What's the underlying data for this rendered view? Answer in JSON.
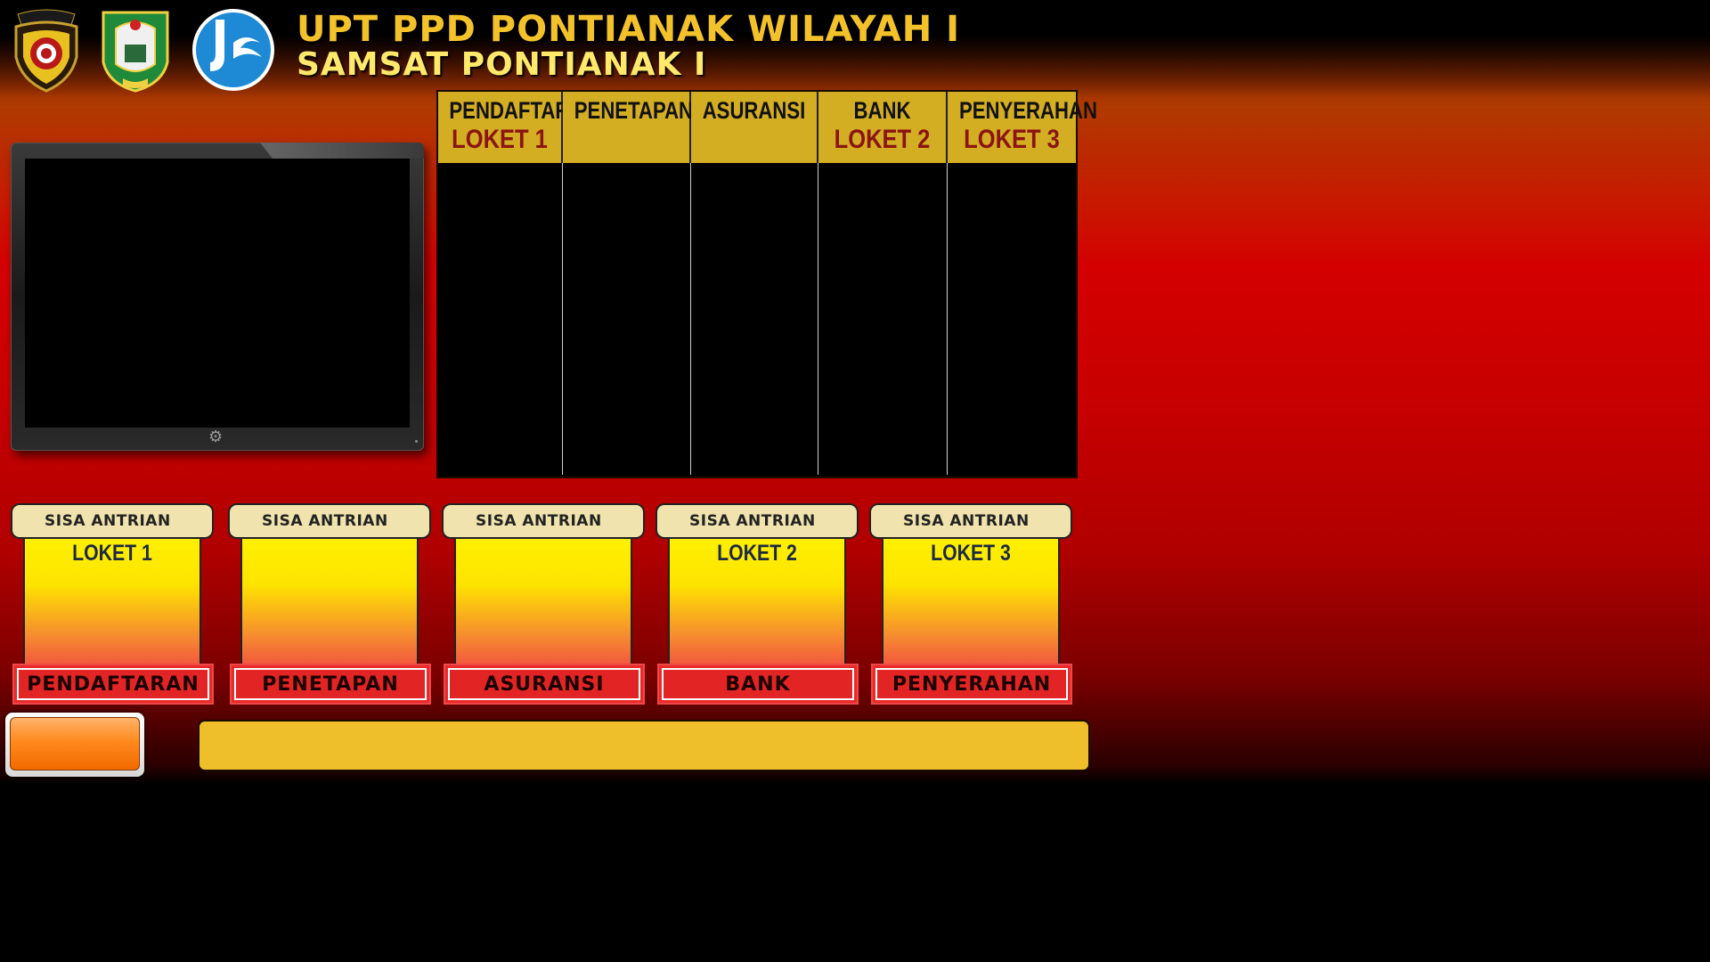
{
  "header": {
    "title": "UPT PPD PONTIANAK WILAYAH I",
    "subtitle": "SAMSAT PONTIANAK I",
    "logos": {
      "police": "KALIMANTAN BARAT",
      "province": "AKCAYA"
    }
  },
  "queue_table": {
    "columns": [
      {
        "label": "PENDAFTARAN",
        "sub": "LOKET 1"
      },
      {
        "label": "PENETAPAN",
        "sub": ""
      },
      {
        "label": "ASURANSI",
        "sub": ""
      },
      {
        "label": "BANK",
        "sub": "LOKET 2"
      },
      {
        "label": "PENYERAHAN",
        "sub": "LOKET 3"
      }
    ]
  },
  "counters": [
    {
      "caption": "SISA ANTRIAN",
      "loket": "LOKET 1",
      "service": "PENDAFTARAN"
    },
    {
      "caption": "SISA ANTRIAN",
      "loket": "",
      "service": "PENETAPAN"
    },
    {
      "caption": "SISA ANTRIAN",
      "loket": "",
      "service": "ASURANSI"
    },
    {
      "caption": "SISA ANTRIAN",
      "loket": "LOKET 2",
      "service": "BANK"
    },
    {
      "caption": "SISA ANTRIAN",
      "loket": "LOKET 3",
      "service": "PENYERAHAN"
    }
  ],
  "marquee": {
    "text": ""
  },
  "colors": {
    "title": "#f3c22a",
    "subtitle": "#ffe86a",
    "table_header": "#d3ad22",
    "loket_text": "#8b1414",
    "counter_button": "#e92a2a",
    "marquee_bg": "#eebf2a"
  },
  "icons": [
    "police-logo",
    "province-logo",
    "jasa-raharja-logo",
    "gear-icon"
  ]
}
